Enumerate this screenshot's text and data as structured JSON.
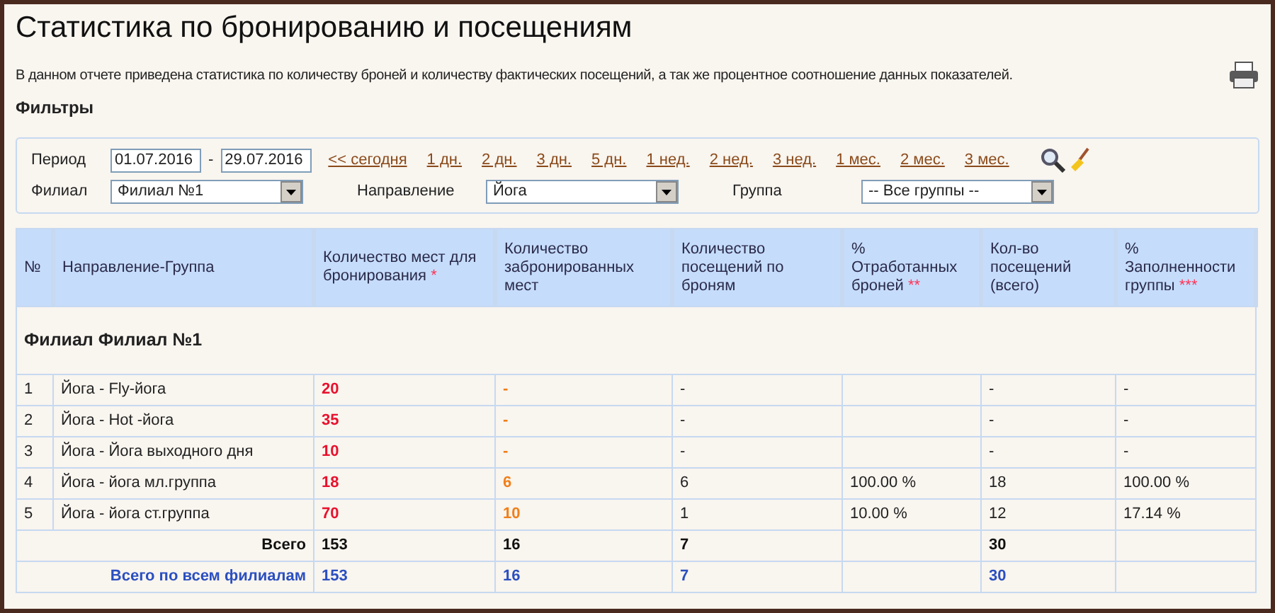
{
  "title": "Статистика по бронированию и посещениям",
  "description": "В данном отчете приведена статистика по количеству броней и количеству фактических посещений, а так же процентное соотношение данных показателей.",
  "filters_heading": "Фильтры",
  "filters": {
    "period_label": "Период",
    "date_from": "01.07.2016",
    "date_separator": "-",
    "date_to": "29.07.2016",
    "quick_links": [
      "<< сегодня",
      "1 дн.",
      "2 дн.",
      "3 дн.",
      "5 дн.",
      "1 нед.",
      "2 нед.",
      "3 нед.",
      "1 мес.",
      "2 мес.",
      "3 мес."
    ],
    "selects": [
      {
        "label": "Филиал",
        "value": "Филиал №1"
      },
      {
        "label": "Направление",
        "value": "Йога"
      },
      {
        "label": "Группа",
        "value": "-- Все группы --"
      }
    ]
  },
  "table": {
    "columns": [
      {
        "label": "№"
      },
      {
        "label": "Направление-Группа"
      },
      {
        "label": "Количество мест для бронирования",
        "mark": "*"
      },
      {
        "label": "Количество забронированных мест"
      },
      {
        "label": "Количество посещений по броням"
      },
      {
        "label": "% Отработанных броней",
        "mark": "**"
      },
      {
        "label": "Кол-во посещений (всего)"
      },
      {
        "label": "% Заполненности группы",
        "mark": "***"
      }
    ],
    "section": "Филиал Филиал №1",
    "rows": [
      {
        "kind": "item",
        "cells": [
          "1",
          "Йога - Fly-йога",
          "20",
          "-",
          "-",
          null,
          "-",
          "-"
        ]
      },
      {
        "kind": "item",
        "cells": [
          "2",
          "Йога - Hot -йога",
          "35",
          "-",
          "-",
          null,
          "-",
          "-"
        ]
      },
      {
        "kind": "item",
        "cells": [
          "3",
          "Йога - Йога выходного дня",
          "10",
          "-",
          "-",
          null,
          "-",
          "-"
        ]
      },
      {
        "kind": "item",
        "cells": [
          "4",
          "Йога - йога мл.группа",
          "18",
          "6",
          "6",
          "100.00 %",
          "18",
          "100.00 %"
        ]
      },
      {
        "kind": "item",
        "cells": [
          "5",
          "Йога - йога ст.группа",
          "70",
          "10",
          "1",
          "10.00 %",
          "12",
          "17.14 %"
        ]
      },
      {
        "kind": "total",
        "label": "Всего",
        "cells": [
          "153",
          "16",
          "7",
          null,
          "30",
          null
        ]
      },
      {
        "kind": "grand_total",
        "label": "Всего по всем филиалам",
        "cells": [
          "153",
          "16",
          "7",
          null,
          "30",
          null
        ]
      }
    ]
  }
}
